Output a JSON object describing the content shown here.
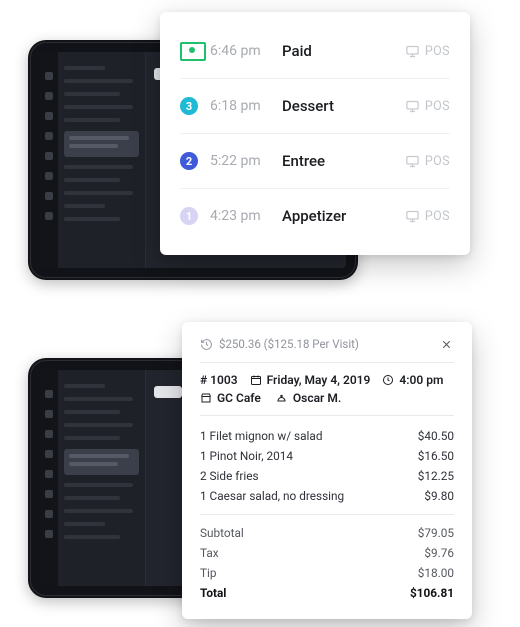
{
  "events": [
    {
      "time": "6:46 pm",
      "label": "Paid",
      "source": "POS",
      "icon": "cash",
      "badge_bg": "",
      "badge_text": ""
    },
    {
      "time": "6:18 pm",
      "label": "Dessert",
      "source": "POS",
      "icon": "badge",
      "badge_bg": "#1fbad6",
      "badge_text": "3"
    },
    {
      "time": "5:22 pm",
      "label": "Entree",
      "source": "POS",
      "icon": "badge",
      "badge_bg": "#3f5bd9",
      "badge_text": "2"
    },
    {
      "time": "4:23 pm",
      "label": "Appetizer",
      "source": "POS",
      "icon": "badge",
      "badge_bg": "#d7d3f3",
      "badge_text": "1"
    }
  ],
  "receipt": {
    "spend_summary": "$250.36 ($125.18 Per Visit)",
    "order_no": "# 1003",
    "date": "Friday, May 4, 2019",
    "time": "4:00 pm",
    "venue": "GC Cafe",
    "server": "Oscar M.",
    "items": [
      {
        "desc": "1 Filet mignon w/ salad",
        "amt": "$40.50"
      },
      {
        "desc": "1 Pinot Noir, 2014",
        "amt": "$16.50"
      },
      {
        "desc": "2 Side fries",
        "amt": "$12.25"
      },
      {
        "desc": "1 Caesar salad, no dressing",
        "amt": "$9.80"
      }
    ],
    "subtotal_label": "Subtotal",
    "subtotal": "$79.05",
    "tax_label": "Tax",
    "tax": "$9.76",
    "tip_label": "Tip",
    "tip": "$18.00",
    "total_label": "Total",
    "total": "$106.81"
  }
}
